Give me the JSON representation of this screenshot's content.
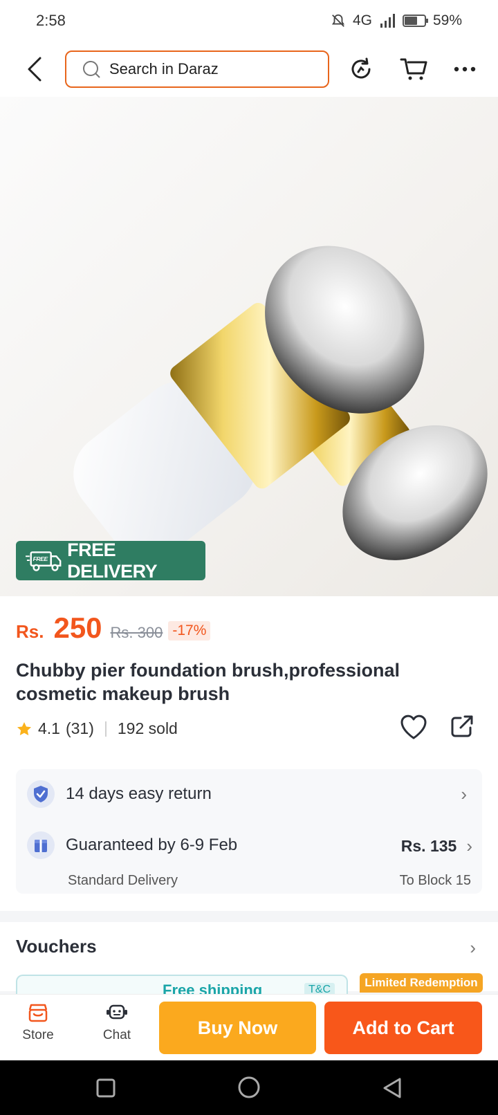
{
  "status_bar": {
    "time": "2:58",
    "network": "4G",
    "battery": "59%"
  },
  "search": {
    "placeholder": "Search in Daraz"
  },
  "badge": {
    "free_tag": "FREE",
    "label": "FREE DELIVERY"
  },
  "product": {
    "currency": "Rs.",
    "price": "250",
    "old_price": "Rs. 300",
    "discount": "-17%",
    "title": "Chubby pier foundation brush,professional cosmetic makeup brush",
    "rating": "4.1",
    "reviews": "(31)",
    "sold": "192 sold"
  },
  "services": {
    "returns": "14 days easy return",
    "delivery": "Guaranteed by 6-9 Feb",
    "delivery_type": "Standard Delivery",
    "delivery_fee": "Rs. 135",
    "delivery_location": "To Block 15"
  },
  "vouchers": {
    "title": "Vouchers",
    "card_label": "Free shipping",
    "tc": "T&C",
    "limited": "Limited Redemption"
  },
  "bottom": {
    "store": "Store",
    "chat": "Chat",
    "buy_now": "Buy Now",
    "add_to_cart": "Add to Cart"
  },
  "colors": {
    "accent": "#f2561d",
    "buy_now": "#fba91e",
    "add_to_cart": "#f8571a",
    "free_badge": "#2f7d62"
  },
  "icons": [
    "back-icon",
    "search-icon",
    "history-icon",
    "cart-icon",
    "more-icon",
    "star-icon",
    "heart-icon",
    "share-icon",
    "shield-icon",
    "delivery-icon",
    "store-icon",
    "chat-icon"
  ]
}
